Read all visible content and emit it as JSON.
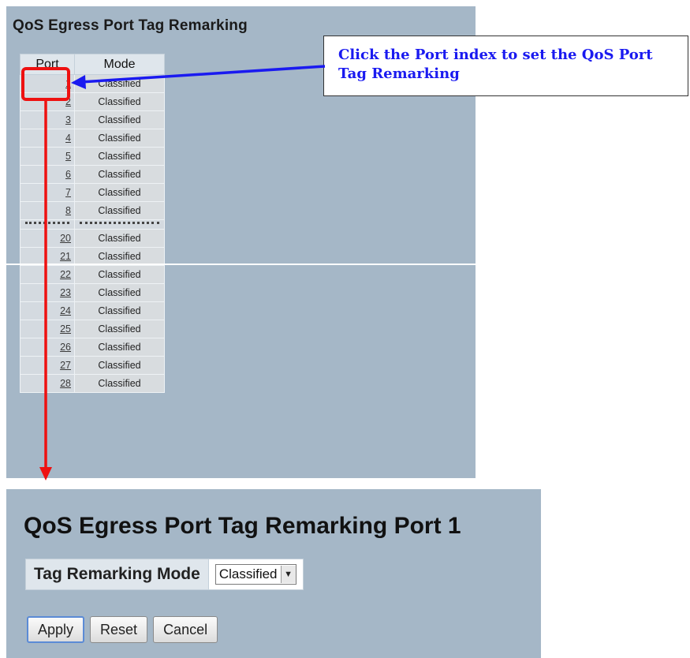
{
  "list_page": {
    "title": "QoS Egress Port Tag Remarking",
    "columns": [
      "Port",
      "Mode"
    ],
    "rows_top": [
      {
        "port": "1",
        "mode": "Classified"
      },
      {
        "port": "2",
        "mode": "Classified"
      },
      {
        "port": "3",
        "mode": "Classified"
      },
      {
        "port": "4",
        "mode": "Classified"
      },
      {
        "port": "5",
        "mode": "Classified"
      },
      {
        "port": "6",
        "mode": "Classified"
      },
      {
        "port": "7",
        "mode": "Classified"
      },
      {
        "port": "8",
        "mode": "Classified"
      }
    ],
    "rows_bottom": [
      {
        "port": "20",
        "mode": "Classified"
      },
      {
        "port": "21",
        "mode": "Classified"
      },
      {
        "port": "22",
        "mode": "Classified"
      },
      {
        "port": "23",
        "mode": "Classified"
      },
      {
        "port": "24",
        "mode": "Classified"
      },
      {
        "port": "25",
        "mode": "Classified"
      },
      {
        "port": "26",
        "mode": "Classified"
      },
      {
        "port": "27",
        "mode": "Classified"
      },
      {
        "port": "28",
        "mode": "Classified"
      }
    ]
  },
  "callout": {
    "text": "Click the Port index to set the QoS Port Tag Remarking",
    "color": "#1a1af0"
  },
  "annotation_colors": {
    "highlight": "#ee1111",
    "blue_arrow": "#1a1af0",
    "red_arrow": "#ee1111"
  },
  "detail_page": {
    "title": "QoS Egress Port Tag Remarking  Port 1",
    "field_label": "Tag Remarking Mode",
    "field_value": "Classified",
    "buttons": {
      "apply": "Apply",
      "reset": "Reset",
      "cancel": "Cancel"
    }
  },
  "icons": {
    "dropdown": "chevron-down-icon"
  }
}
